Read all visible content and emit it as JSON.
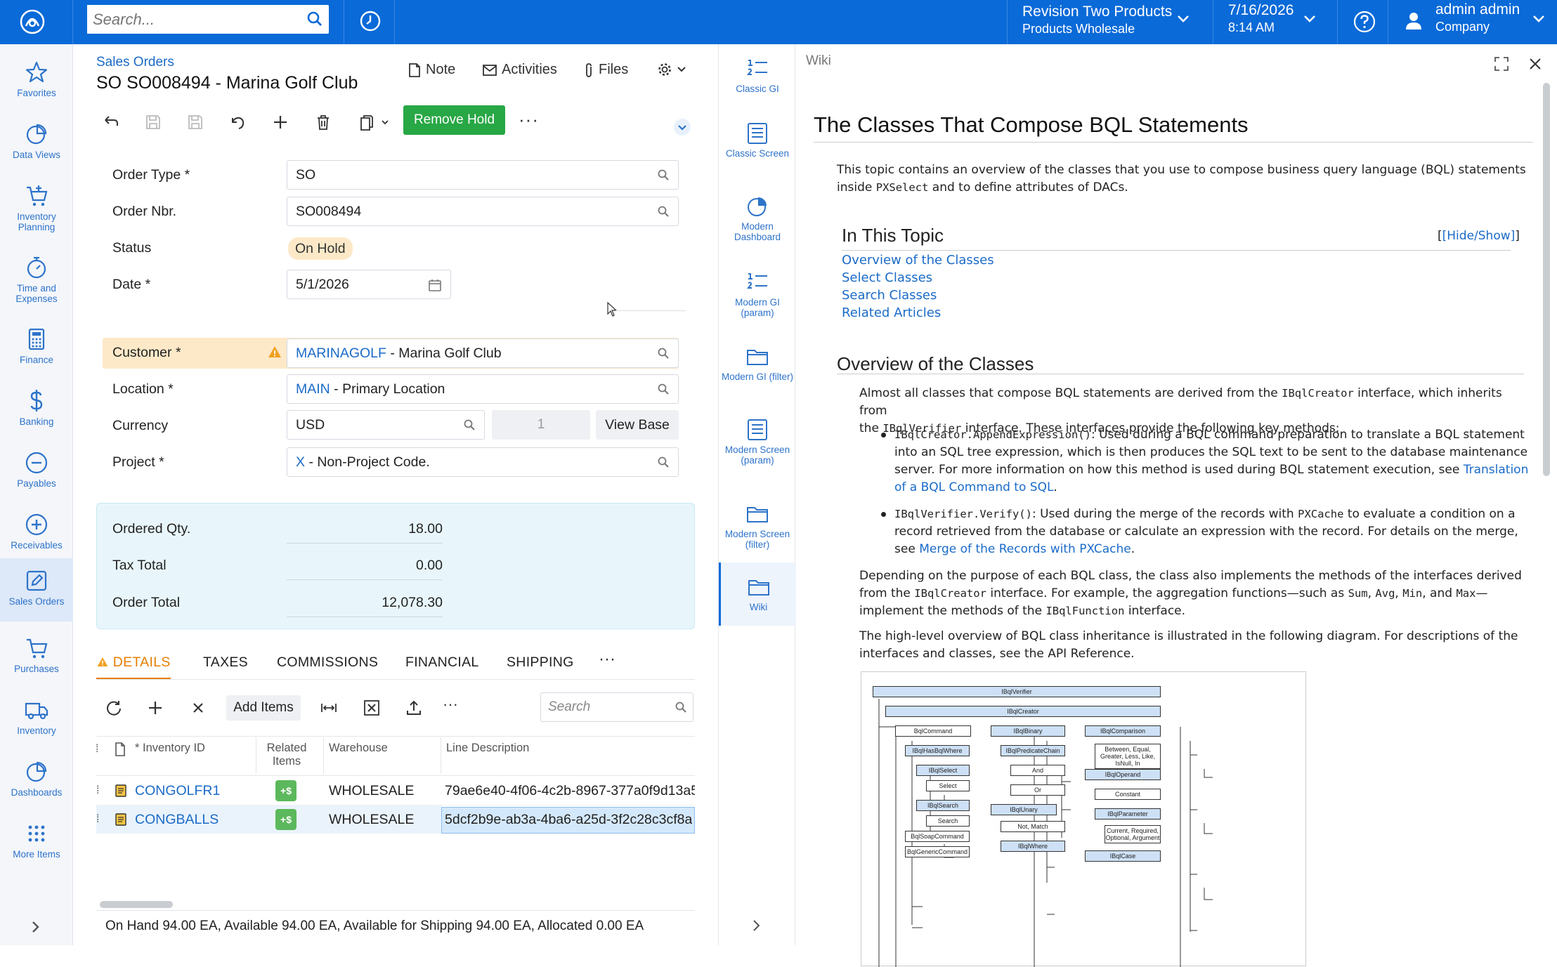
{
  "topbar": {
    "search_placeholder": "Search...",
    "company_line1": "Revision Two Products",
    "company_line2": "Products Wholesale",
    "date_line1": "7/16/2026",
    "date_line2": "8:14 AM",
    "user_line1": "admin admin",
    "user_line2": "Company"
  },
  "nav": [
    {
      "label": "Favorites",
      "icon": "star-icon"
    },
    {
      "label": "Data Views",
      "icon": "pie-chart-icon"
    },
    {
      "label": "Inventory Planning",
      "icon": "cart-plus-icon"
    },
    {
      "label": "Time and Expenses",
      "icon": "stopwatch-icon"
    },
    {
      "label": "Finance",
      "icon": "calculator-icon"
    },
    {
      "label": "Banking",
      "icon": "dollar-icon"
    },
    {
      "label": "Payables",
      "icon": "minus-circle-icon"
    },
    {
      "label": "Receivables",
      "icon": "plus-circle-icon"
    },
    {
      "label": "Sales Orders",
      "icon": "pencil-square-icon"
    },
    {
      "label": "Purchases",
      "icon": "cart-icon"
    },
    {
      "label": "Inventory",
      "icon": "truck-icon"
    },
    {
      "label": "Dashboards",
      "icon": "dashboard-icon"
    },
    {
      "label": "More Items",
      "icon": "grid-dots-icon"
    }
  ],
  "form": {
    "breadcrumb": "Sales Orders",
    "title": "SO SO008494 - Marina Golf Club",
    "note_label": "Note",
    "activities_label": "Activities",
    "files_label": "Files",
    "remove_hold_label": "Remove Hold",
    "more_label": "···",
    "order_type_label": "Order Type *",
    "order_type_value": "SO",
    "order_nbr_label": "Order Nbr.",
    "order_nbr_value": "SO008494",
    "status_label": "Status",
    "status_value": "On Hold",
    "date_label": "Date *",
    "date_value": "5/1/2026",
    "customer_label": "Customer *",
    "customer_code": "MARINAGOLF",
    "customer_name": " - Marina Golf Club",
    "location_label": "Location *",
    "location_code": "MAIN",
    "location_name": " - Primary Location",
    "currency_label": "Currency",
    "currency_value": "USD",
    "currency_rate": "1",
    "view_base_label": "View Base",
    "project_label": "Project *",
    "project_code": "X",
    "project_name": " - Non-Project Code."
  },
  "totals": {
    "ordered_qty_label": "Ordered Qty.",
    "ordered_qty_value": "18.00",
    "tax_total_label": "Tax Total",
    "tax_total_value": "0.00",
    "order_total_label": "Order Total",
    "order_total_value": "12,078.30"
  },
  "tabs": [
    "DETAILS",
    "TAXES",
    "COMMISSIONS",
    "FINANCIAL",
    "SHIPPING",
    "···"
  ],
  "grid": {
    "add_items_label": "Add Items",
    "search_placeholder": "Search",
    "more_label": "···",
    "headers": {
      "inventory_id": "* Inventory ID",
      "related_items": "Related Items",
      "warehouse": "Warehouse",
      "line_description": "Line Description"
    },
    "related_badge": "+$",
    "rows": [
      {
        "inventory_id": "CONGOLFR1",
        "warehouse": "WHOLESALE",
        "line_description": "79ae6e40-4f06-4c2b-8967-377a0f9d13a5"
      },
      {
        "inventory_id": "CONGBALLS",
        "warehouse": "WHOLESALE",
        "line_description": "5dcf2b9e-ab3a-4ba6-a25d-3f2c28c3cf8a"
      }
    ],
    "status_text": "On Hand 94.00 EA, Available 94.00 EA, Available for Shipping 94.00 EA, Allocated 0.00 EA"
  },
  "rail": [
    {
      "label": "Classic GI",
      "icon": "numbered-list-icon"
    },
    {
      "label": "Classic Screen",
      "icon": "screen-icon"
    },
    {
      "label": "Modern Dashboard",
      "icon": "pie-chart-icon"
    },
    {
      "label": "Modern GI (param)",
      "icon": "numbered-list-icon"
    },
    {
      "label": "Modern GI (filter)",
      "icon": "folder-icon"
    },
    {
      "label": "Modern Screen (param)",
      "icon": "screen-icon"
    },
    {
      "label": "Modern Screen (filter)",
      "icon": "folder-icon"
    },
    {
      "label": "Wiki",
      "icon": "folder-icon"
    }
  ],
  "wiki": {
    "panel_label": "Wiki",
    "title": "The Classes That Compose BQL Statements",
    "intro_a": "This topic contains an overview of the classes that you use to compose business query language (BQL) statements",
    "intro_b1": "inside ",
    "intro_code": "PXSelect",
    "intro_b2": " and to define attributes of DACs.",
    "toc_title": "In This Topic",
    "toc_toggle": "[Hide/Show]",
    "toc": [
      "Overview of the Classes",
      "Select Classes",
      "Search Classes",
      "Related Articles"
    ],
    "overview_title": "Overview of the Classes",
    "p1_a": "Almost all classes that compose BQL statements are derived from the ",
    "p1_code1": "IBqlCreator",
    "p1_b": " interface, which inherits from",
    "p1_c": "the ",
    "p1_code2": "IBqlVerifier",
    "p1_d": " interface. These interfaces provide the following key methods:",
    "b1_code": "IBqlCreator.AppendExpression()",
    "b1_a": ": Used during a BQL command preparation to translate a BQL statement",
    "b1_b": "into an SQL tree expression, which is then produces the SQL text to be sent to the database maintenance",
    "b1_c": "server. For more information on how this method is used during BQL statement execution, see ",
    "b1_link1": "Translation",
    "b1_link2": "of a BQL Command to SQL",
    "b1_end": ".",
    "b2_code": "IBqlVerifier.Verify()",
    "b2_a": ": Used during the merge of the records with ",
    "b2_code2": "PXCache",
    "b2_b": " to evaluate a condition on a",
    "b2_c": "record retrieved from the database or calculate an expression with the record. For details on the merge,",
    "b2_d": "see ",
    "b2_link": "Merge of the Records with PXCache",
    "b2_end": ".",
    "p2_a": "Depending on the purpose of each BQL class, the class also implements the methods of the interfaces derived",
    "p2_b1": "from the ",
    "p2_code1": "IBqlCreator",
    "p2_b2": " interface. For example, the aggregation functions—such as ",
    "p2_code2": "Sum",
    "p2_c1": ", ",
    "p2_code3": "Avg",
    "p2_c2": ", ",
    "p2_code4": "Min",
    "p2_c3": ", and ",
    "p2_code5": "Max",
    "p2_c4": "—",
    "p2_d1": "implement the methods of the ",
    "p2_code6": "IBqlFunction",
    "p2_d2": " interface.",
    "p3_a": "The high-level overview of BQL class inheritance is illustrated in the following diagram. For descriptions of the",
    "p3_b": "interfaces and classes, see the API Reference.",
    "diagram": {
      "root": "IBqlVerifier",
      "creator": "IBqlCreator",
      "col1": [
        "BqlCommand",
        "IBqlHasBqlWhere",
        "IBqlSelect",
        "Select",
        "IBqlSearch",
        "Search",
        "BqlSoapCommand",
        "BqlGenericCommand"
      ],
      "col2": [
        "IBqlBinary",
        "IBqlPredicateChain",
        "And",
        "Or",
        "IBqlUnary",
        "Not, Match",
        "IBqlWhere"
      ],
      "col3": [
        "IBqlComparison",
        "Between, Equal, Greater, Less, Like, IsNull, In",
        "IBqlOperand",
        "Constant",
        "IBqlParameter",
        "Current, Required, Optional, Argument",
        "IBqlCase"
      ]
    }
  },
  "colors": {
    "topbar": "#0a6ad8",
    "accent_button": "#28a745",
    "status_badge": "#fde9c8",
    "link": "#1b6bc8",
    "active_tab": "#e67e00"
  }
}
